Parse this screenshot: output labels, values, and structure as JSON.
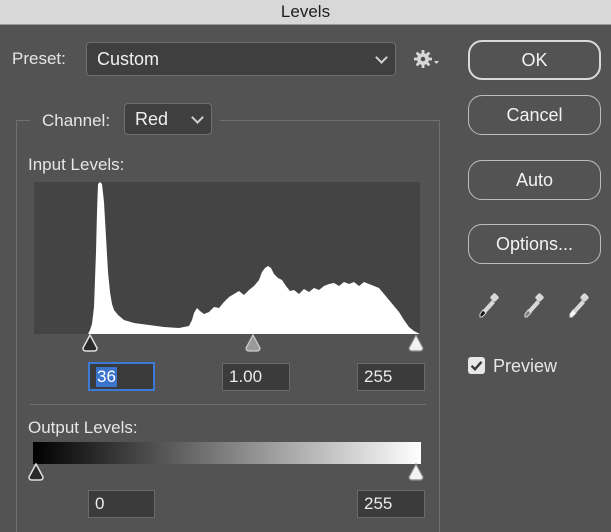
{
  "window": {
    "title": "Levels"
  },
  "preset": {
    "label": "Preset:",
    "value": "Custom"
  },
  "channel": {
    "label": "Channel:",
    "value": "Red"
  },
  "input_levels": {
    "label": "Input Levels:",
    "black": "36",
    "gamma": "1.00",
    "white": "255"
  },
  "output_levels": {
    "label": "Output Levels:",
    "black": "0",
    "white": "255"
  },
  "buttons": {
    "ok": "OK",
    "cancel": "Cancel",
    "auto": "Auto",
    "options": "Options..."
  },
  "preview": {
    "label": "Preview",
    "checked": true
  },
  "icons": [
    "gear-icon",
    "black-point-eyedropper-icon",
    "gray-point-eyedropper-icon",
    "white-point-eyedropper-icon"
  ],
  "colors": {
    "panel": "#535353",
    "field": "#3b3b3b",
    "focus": "#3d7ad6",
    "histogram": "#ffffff"
  }
}
